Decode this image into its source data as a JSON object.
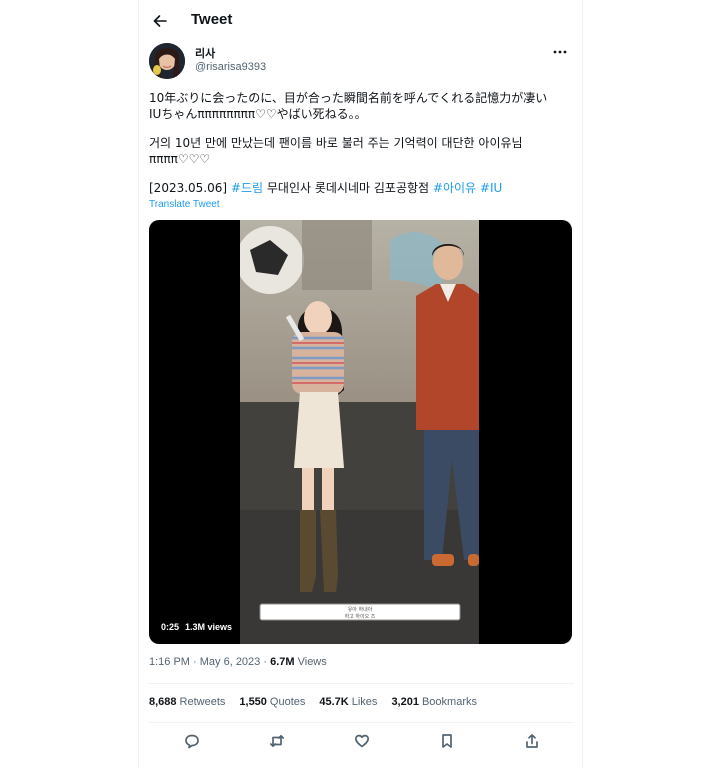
{
  "header": {
    "title": "Tweet"
  },
  "author": {
    "display_name": "리사",
    "handle": "@risarisa9393"
  },
  "tweet": {
    "text_ja": "10年ぶりに会ったのに、目が合った瞬間名前を呼んでくれる記憶力が凄い\nIUちゃんππππππππ♡♡やばい死ねる。。",
    "text_ko": "거의 10년 만에 만났는데 팬이름 바로 불러 주는 기억력이 대단한 아이유님\nππππ♡♡♡",
    "date_tag": "[2023.05.06]",
    "hashtag_1": "#드림",
    "venue": "무대인사 롯데시네마 김포공항점",
    "hashtag_2": "#아이유",
    "hashtag_3": "#IU",
    "translate_label": "Translate Tweet"
  },
  "media": {
    "duration": "0:25",
    "views": "1.3M views",
    "caption_line_1": "유아 하내아",
    "caption_line_2": "하고 하이오 즈"
  },
  "meta": {
    "time": "1:16 PM",
    "date": "May 6, 2023",
    "views_count": "6.7M",
    "views_label": "Views"
  },
  "stats": {
    "retweets_count": "8,688",
    "retweets_label": "Retweets",
    "quotes_count": "1,550",
    "quotes_label": "Quotes",
    "likes_count": "45.7K",
    "likes_label": "Likes",
    "bookmarks_count": "3,201",
    "bookmarks_label": "Bookmarks"
  },
  "icons": {
    "back": "arrow-left-icon",
    "more": "more-horizontal-icon",
    "reply": "reply-icon",
    "retweet": "retweet-icon",
    "like": "heart-icon",
    "bookmark": "bookmark-icon",
    "share": "share-icon"
  },
  "colors": {
    "accent": "#1d9bf0",
    "text": "#0f1419",
    "secondary": "#536471",
    "border": "#eff3f4"
  }
}
